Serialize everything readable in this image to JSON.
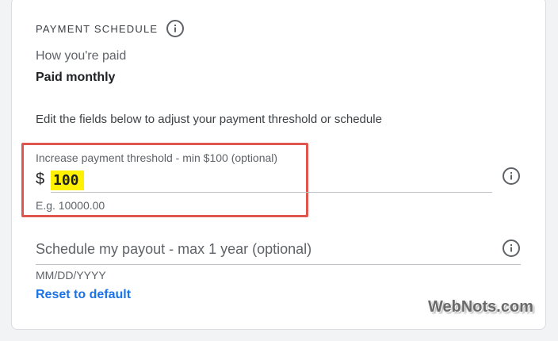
{
  "payment_schedule": {
    "section_title": "PAYMENT SCHEDULE",
    "title_info_icon": "info-icon",
    "how_paid_label": "How you're paid",
    "how_paid_value": "Paid monthly",
    "instructions": "Edit the fields below to adjust your payment threshold or schedule",
    "threshold": {
      "label": "Increase payment threshold - min $100 (optional)",
      "currency_symbol": "$",
      "value": "100",
      "hint": "E.g. 10000.00",
      "info_icon": "info-icon"
    },
    "payout": {
      "label": "Schedule my payout - max 1 year (optional)",
      "hint": "MM/DD/YYYY",
      "info_icon": "info-icon"
    },
    "reset_label": "Reset to default"
  },
  "watermark": "WebNots.com",
  "colors": {
    "accent_link": "#1a73e8",
    "highlight_border": "#e0554e",
    "value_highlight": "#fff200"
  }
}
